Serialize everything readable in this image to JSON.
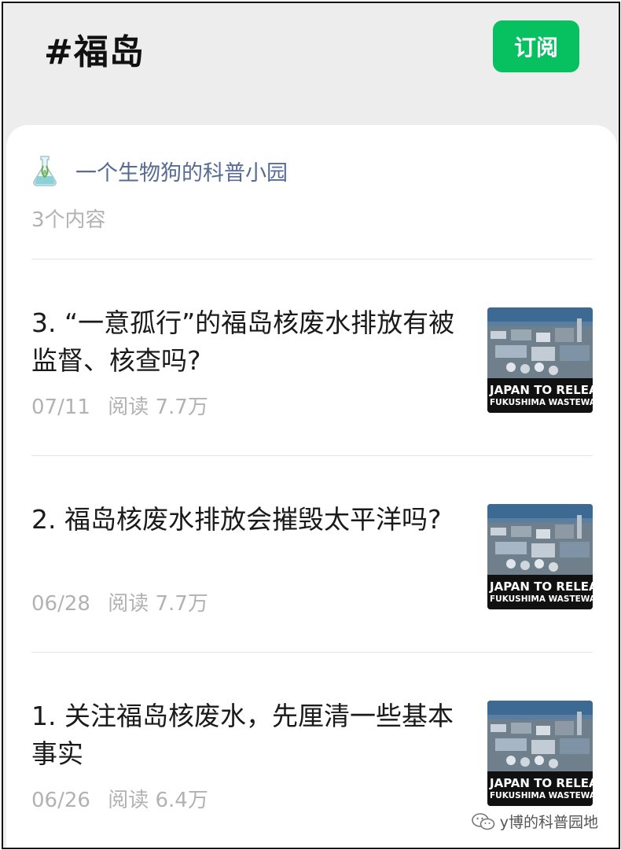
{
  "header": {
    "title": "#福岛",
    "subscribe_label": "订阅"
  },
  "account": {
    "icon": "flask-icon",
    "name": "一个生物狗的科普小园",
    "content_count": "3个内容"
  },
  "articles": [
    {
      "title": "3. “一意孤行”的福岛核废水排放有被监督、核查吗?",
      "date": "07/11",
      "read_label": "阅读",
      "read_count": "7.7万",
      "thumb_line1": "JAPAN TO RELEA",
      "thumb_line2": "FUKUSHIMA WASTEWA"
    },
    {
      "title": "2. 福岛核废水排放会摧毁太平洋吗?",
      "date": "06/28",
      "read_label": "阅读",
      "read_count": "7.7万",
      "thumb_line1": "JAPAN TO RELEA",
      "thumb_line2": "FUKUSHIMA WASTEWA"
    },
    {
      "title": "1. 关注福岛核废水，先厘清一些基本事实",
      "date": "06/26",
      "read_label": "阅读",
      "read_count": "6.4万",
      "thumb_line1": "JAPAN TO RELEA",
      "thumb_line2": "FUKUSHIMA WASTEWA"
    }
  ],
  "watermark": {
    "icon": "wechat-icon",
    "text": "y博的科普园地"
  },
  "colors": {
    "accent": "#07c160",
    "link": "#576b95",
    "muted": "#b2b2b2"
  }
}
